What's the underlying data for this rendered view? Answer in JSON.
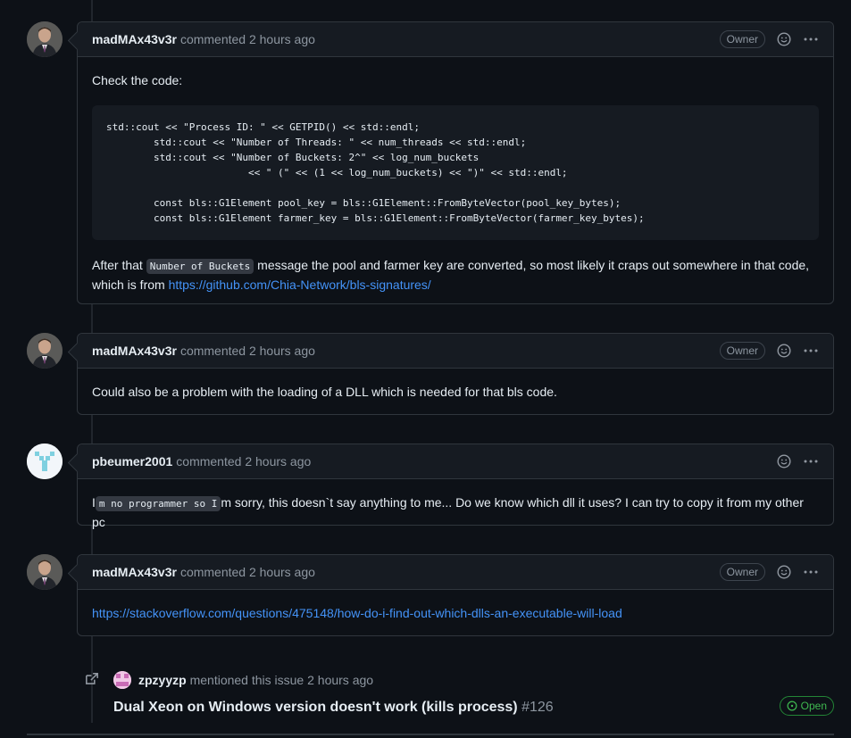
{
  "comments": [
    {
      "author": "madMAx43v3r",
      "meta": "commented 2 hours ago",
      "badge": "Owner",
      "intro": "Check the code:",
      "code": "std::cout << \"Process ID: \" << GETPID() << std::endl;\n        std::cout << \"Number of Threads: \" << num_threads << std::endl;\n        std::cout << \"Number of Buckets: 2^\" << log_num_buckets\n                        << \" (\" << (1 << log_num_buckets) << \")\" << std::endl;\n\n        const bls::G1Element pool_key = bls::G1Element::FromByteVector(pool_key_bytes);\n        const bls::G1Element farmer_key = bls::G1Element::FromByteVector(farmer_key_bytes);",
      "after_before": "After that ",
      "after_code": "Number of Buckets",
      "after_rest": " message the pool and farmer key are converted, so most likely it craps out somewhere in that code, which is from ",
      "link": "https://github.com/Chia-Network/bls-signatures/"
    },
    {
      "author": "madMAx43v3r",
      "meta": "commented 2 hours ago",
      "badge": "Owner",
      "text": "Could also be a problem with the loading of a DLL which is needed for that bls code."
    },
    {
      "author": "pbeumer2001",
      "meta": "commented 2 hours ago",
      "text_a": "I",
      "text_code": "m no programmer so I",
      "text_b": "m sorry, this doesn`t say anything to me... Do we know which dll it uses? I can try to copy it from my other pc"
    },
    {
      "author": "madMAx43v3r",
      "meta": "commented 2 hours ago",
      "badge": "Owner",
      "link": "https://stackoverflow.com/questions/475148/how-do-i-find-out-which-dlls-an-executable-will-load"
    }
  ],
  "event": {
    "user": "zpzyyzp",
    "action": "mentioned this issue",
    "time": "2 hours ago",
    "title": "Dual Xeon on Windows version doesn't work (kills process)",
    "number": "#126",
    "status": "Open"
  },
  "colors": {
    "background": "#0d1117",
    "header": "#161b22",
    "border": "#30363d",
    "link": "#4493f8",
    "open": "#3fb950"
  }
}
